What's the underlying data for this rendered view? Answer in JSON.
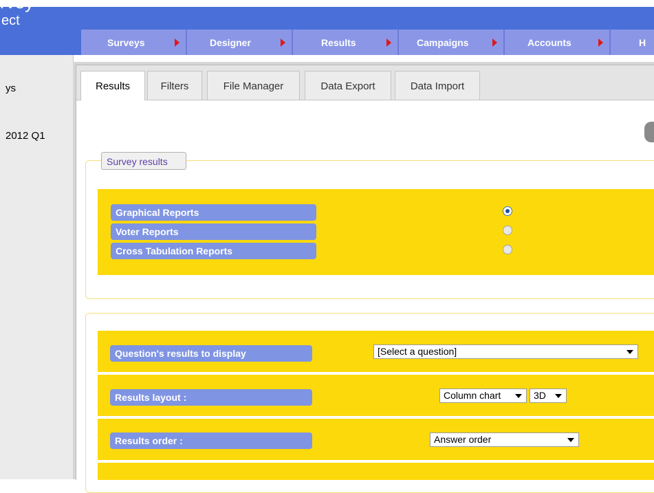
{
  "app": {
    "logo_line1": "rvey",
    "logo_line2": "ect"
  },
  "nav": {
    "tabs": [
      {
        "label": "Surveys"
      },
      {
        "label": "Designer"
      },
      {
        "label": "Results"
      },
      {
        "label": "Campaigns"
      },
      {
        "label": "Accounts"
      },
      {
        "label": "H"
      }
    ]
  },
  "sidebar": {
    "items": [
      {
        "label": "ys"
      },
      {
        "label": "2012 Q1"
      }
    ]
  },
  "tabs": [
    {
      "label": "Results",
      "active": true
    },
    {
      "label": "Filters"
    },
    {
      "label": "File Manager"
    },
    {
      "label": "Data Export"
    },
    {
      "label": "Data Import"
    }
  ],
  "survey_results": {
    "legend": "Survey results",
    "options": [
      {
        "label": "Graphical Reports",
        "checked": true
      },
      {
        "label": "Voter Reports",
        "checked": false
      },
      {
        "label": "Cross Tabulation Reports",
        "checked": false
      }
    ]
  },
  "settings": {
    "question_label": "Question's results to display",
    "question_value": "[Select a question]",
    "layout_label": "Results layout :",
    "layout_chart_value": "Column chart",
    "layout_dim_value": "3D",
    "order_label": "Results order :",
    "order_value": "Answer order"
  },
  "colors": {
    "header": "#4a6fd8",
    "nav_tab": "#8b97e6",
    "panel_yellow": "#fcd90a",
    "pill": "#7f94e2"
  }
}
